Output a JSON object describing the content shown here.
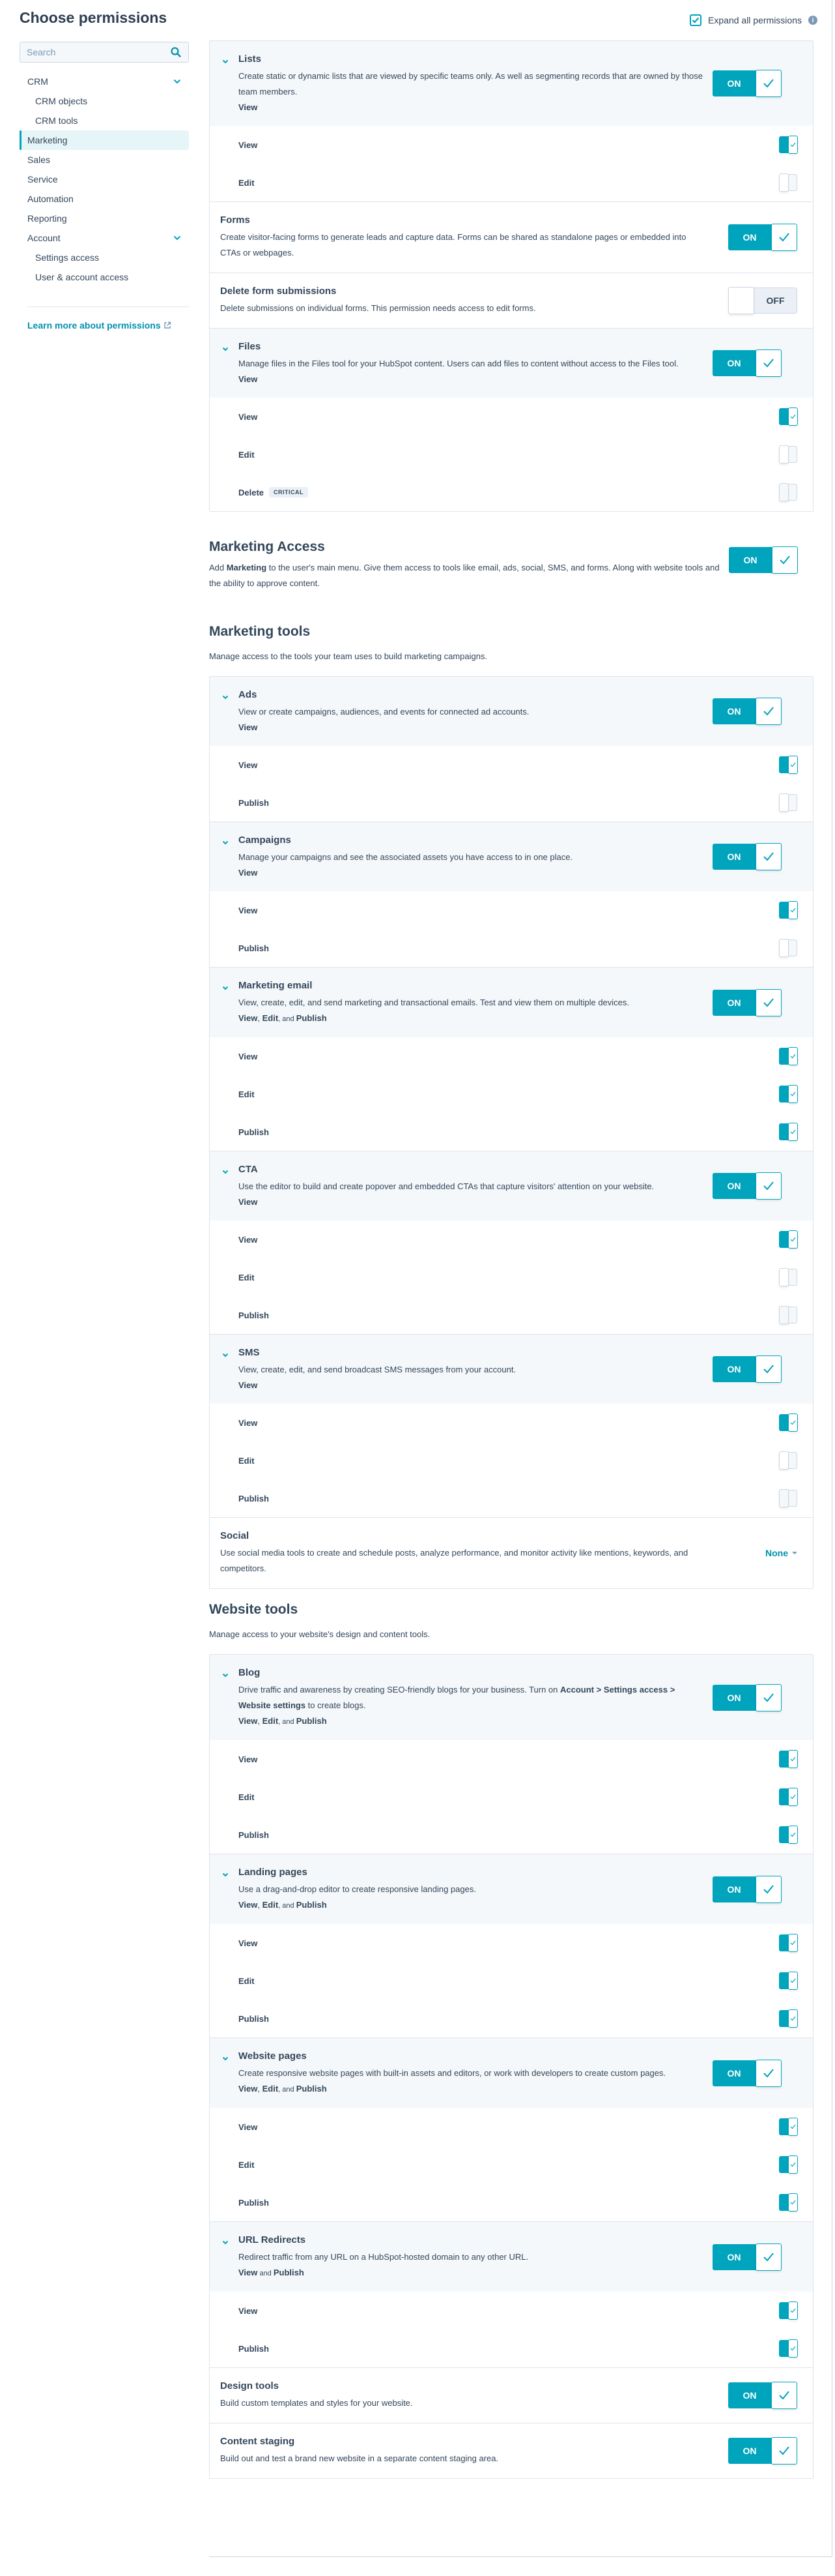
{
  "page": {
    "title": "Choose permissions"
  },
  "search": {
    "placeholder": "Search",
    "value": ""
  },
  "expand_all": {
    "label": "Expand all permissions",
    "checked": true
  },
  "sidebar": {
    "items": [
      {
        "label": "CRM",
        "expandable": true,
        "level": 0
      },
      {
        "label": "CRM objects",
        "level": 1
      },
      {
        "label": "CRM tools",
        "level": 1
      },
      {
        "label": "Marketing",
        "level": 0,
        "active": true
      },
      {
        "label": "Sales",
        "level": 0
      },
      {
        "label": "Service",
        "level": 0
      },
      {
        "label": "Automation",
        "level": 0
      },
      {
        "label": "Reporting",
        "level": 0
      },
      {
        "label": "Account",
        "expandable": true,
        "level": 0
      },
      {
        "label": "Settings access",
        "level": 1
      },
      {
        "label": "User & account access",
        "level": 1
      }
    ],
    "learn_link": "Learn more about permissions"
  },
  "toggle_labels": {
    "on": "ON",
    "off": "OFF"
  },
  "top_card": {
    "lists": {
      "title": "Lists",
      "desc": "Create static or dynamic lists that are viewed by specific teams only. As well as segmenting records that are owned by those team members.",
      "summary": "View",
      "state": "on",
      "subs": [
        {
          "label": "View",
          "state": "on"
        },
        {
          "label": "Edit",
          "state": "off"
        }
      ]
    },
    "forms": {
      "title": "Forms",
      "desc": "Create visitor-facing forms to generate leads and capture data. Forms can be shared as standalone pages or embedded into CTAs or webpages.",
      "state": "on"
    },
    "delete_forms": {
      "title": "Delete form submissions",
      "desc": "Delete submissions on individual forms. This permission needs access to edit forms.",
      "state": "off"
    },
    "files": {
      "title": "Files",
      "desc": "Manage files in the Files tool for your HubSpot content. Users can add files to content without access to the Files tool.",
      "summary": "View",
      "state": "on",
      "subs": [
        {
          "label": "View",
          "state": "on"
        },
        {
          "label": "Edit",
          "state": "off"
        },
        {
          "label": "Delete",
          "state": "disabled",
          "badge": "CRITICAL"
        }
      ]
    }
  },
  "marketing_access": {
    "title": "Marketing Access",
    "desc_pre": "Add ",
    "desc_bold": "Marketing",
    "desc_post": " to the user's main menu. Give them access to tools like email, ads, social, SMS, and forms. Along with website tools and the ability to approve content.",
    "state": "on"
  },
  "marketing_tools": {
    "title": "Marketing tools",
    "desc": "Manage access to the tools your team uses to build marketing campaigns.",
    "groups": [
      {
        "title": "Ads",
        "desc": "View or create campaigns, audiences, and events for connected ad accounts.",
        "summary": [
          {
            "b": "View"
          }
        ],
        "state": "on",
        "subs": [
          {
            "label": "View",
            "state": "on"
          },
          {
            "label": "Publish",
            "state": "off"
          }
        ]
      },
      {
        "title": "Campaigns",
        "desc": "Manage your campaigns and see the associated assets you have access to in one place.",
        "summary": [
          {
            "b": "View"
          }
        ],
        "state": "on",
        "subs": [
          {
            "label": "View",
            "state": "on"
          },
          {
            "label": "Publish",
            "state": "off"
          }
        ]
      },
      {
        "title": "Marketing email",
        "desc": "View, create, edit, and send marketing and transactional emails. Test and view them on multiple devices.",
        "summary": [
          {
            "b": "View"
          },
          {
            "t": ", "
          },
          {
            "b": "Edit"
          },
          {
            "s": ", and "
          },
          {
            "b": "Publish"
          }
        ],
        "state": "on",
        "subs": [
          {
            "label": "View",
            "state": "on"
          },
          {
            "label": "Edit",
            "state": "on"
          },
          {
            "label": "Publish",
            "state": "on"
          }
        ]
      },
      {
        "title": "CTA",
        "desc": "Use the editor to build and create popover and embedded CTAs that capture visitors' attention on your website.",
        "summary": [
          {
            "b": "View"
          }
        ],
        "state": "on",
        "subs": [
          {
            "label": "View",
            "state": "on"
          },
          {
            "label": "Edit",
            "state": "off"
          },
          {
            "label": "Publish",
            "state": "disabled"
          }
        ]
      },
      {
        "title": "SMS",
        "desc": "View, create, edit, and send broadcast SMS messages from your account.",
        "summary": [
          {
            "b": "View"
          }
        ],
        "state": "on",
        "subs": [
          {
            "label": "View",
            "state": "on"
          },
          {
            "label": "Edit",
            "state": "off"
          },
          {
            "label": "Publish",
            "state": "disabled"
          }
        ]
      }
    ],
    "social": {
      "title": "Social",
      "desc": "Use social media tools to create and schedule posts, analyze performance, and monitor activity like mentions, keywords, and competitors.",
      "value": "None"
    }
  },
  "website_tools": {
    "title": "Website tools",
    "desc": "Manage access to your website's design and content tools.",
    "groups": [
      {
        "title": "Blog",
        "desc_parts": [
          {
            "t": "Drive traffic and awareness by creating SEO-friendly blogs for your business. Turn on "
          },
          {
            "b": "Account > Settings access > Website settings"
          },
          {
            "t": " to create blogs."
          }
        ],
        "summary": [
          {
            "b": "View"
          },
          {
            "t": ", "
          },
          {
            "b": "Edit"
          },
          {
            "s": ", and "
          },
          {
            "b": "Publish"
          }
        ],
        "state": "on",
        "subs": [
          {
            "label": "View",
            "state": "on"
          },
          {
            "label": "Edit",
            "state": "on"
          },
          {
            "label": "Publish",
            "state": "on"
          }
        ]
      },
      {
        "title": "Landing pages",
        "desc_parts": [
          {
            "t": "Use a drag-and-drop editor to create responsive landing pages."
          }
        ],
        "summary": [
          {
            "b": "View"
          },
          {
            "t": ", "
          },
          {
            "b": "Edit"
          },
          {
            "s": ", and "
          },
          {
            "b": "Publish"
          }
        ],
        "state": "on",
        "subs": [
          {
            "label": "View",
            "state": "on"
          },
          {
            "label": "Edit",
            "state": "on"
          },
          {
            "label": "Publish",
            "state": "on"
          }
        ]
      },
      {
        "title": "Website pages",
        "desc_parts": [
          {
            "t": "Create responsive website pages with built-in assets and editors, or work with developers to create custom pages."
          }
        ],
        "summary": [
          {
            "b": "View"
          },
          {
            "t": ", "
          },
          {
            "b": "Edit"
          },
          {
            "s": ", and "
          },
          {
            "b": "Publish"
          }
        ],
        "state": "on",
        "subs": [
          {
            "label": "View",
            "state": "on"
          },
          {
            "label": "Edit",
            "state": "on"
          },
          {
            "label": "Publish",
            "state": "on"
          }
        ]
      },
      {
        "title": "URL Redirects",
        "desc_parts": [
          {
            "t": "Redirect traffic from any URL on a HubSpot-hosted domain to any other URL."
          }
        ],
        "summary": [
          {
            "b": "View"
          },
          {
            "s": " and "
          },
          {
            "b": "Publish"
          }
        ],
        "state": "on",
        "subs": [
          {
            "label": "View",
            "state": "on"
          },
          {
            "label": "Publish",
            "state": "on"
          }
        ]
      }
    ],
    "plain": [
      {
        "title": "Design tools",
        "desc": "Build custom templates and styles for your website.",
        "state": "on"
      },
      {
        "title": "Content staging",
        "desc": "Build out and test a brand new website in a separate content staging area.",
        "state": "on"
      }
    ]
  },
  "colors": {
    "accent": "#00a4bd",
    "link": "#0091ae",
    "text": "#33475b",
    "panel": "#f5f8fa",
    "border": "#dfe3eb"
  }
}
